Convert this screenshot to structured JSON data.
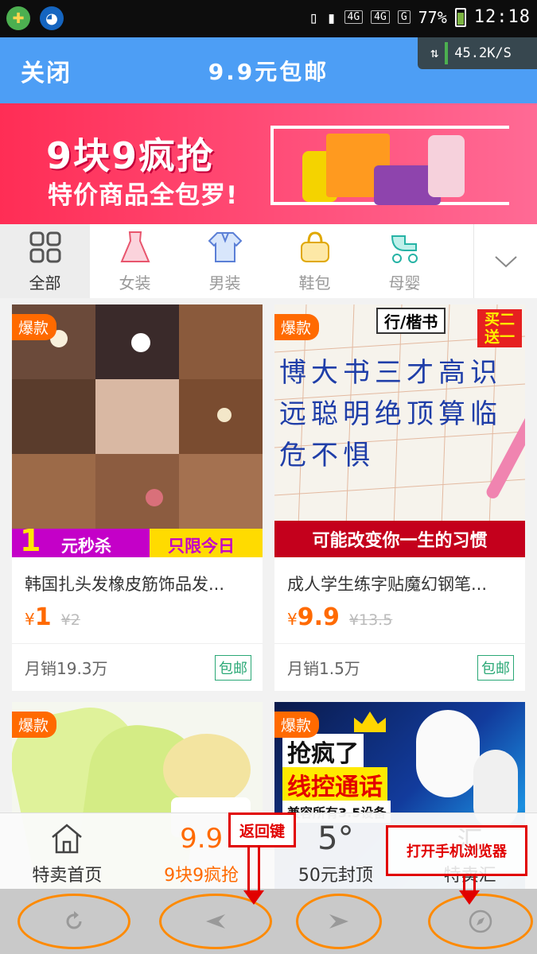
{
  "status_bar": {
    "net_label_1": "4G",
    "net_label_2": "4G",
    "net_label_3": "G",
    "battery": "77%",
    "time": "12:18"
  },
  "header": {
    "close_label": "关闭",
    "title": "9.9元包邮",
    "net_speed": "45.2K/S"
  },
  "banner": {
    "title": "9块9疯抢",
    "subtitle": "特价商品全包罗!"
  },
  "categories": [
    {
      "label": "全部",
      "icon": "grid-icon",
      "active": true
    },
    {
      "label": "女装",
      "icon": "dress-icon",
      "active": false
    },
    {
      "label": "男装",
      "icon": "shirt-icon",
      "active": false
    },
    {
      "label": "鞋包",
      "icon": "handbag-icon",
      "active": false
    },
    {
      "label": "母婴",
      "icon": "stroller-icon",
      "active": false
    }
  ],
  "products": [
    {
      "badge": "爆款",
      "title": "韩国扎头发橡皮筋饰品发...",
      "price_symbol": "¥",
      "price": "1",
      "original_price": "¥2",
      "sales": "月销19.3万",
      "shipping": "包邮",
      "promo_left": "1",
      "promo_mid": "元秒杀",
      "promo_right": "只限今日"
    },
    {
      "badge": "爆款",
      "title": "成人学生练字贴魔幻钢笔...",
      "price_symbol": "¥",
      "price": "9.9",
      "original_price": "¥13.5",
      "sales": "月销1.5万",
      "shipping": "包邮",
      "tag": "行/楷书",
      "deal_1": "买二",
      "deal_2": "送一",
      "slogan": "可能改变你一生的习惯",
      "characters": "博大书三才高识远聪明绝顶算临危不惧"
    },
    {
      "badge": "爆款"
    },
    {
      "badge": "爆款",
      "line1": "抢疯了",
      "line2": "线控通话",
      "line3": "兼容所有3.5设备"
    }
  ],
  "tabbar": [
    {
      "label": "特卖首页",
      "icon": "home-icon",
      "icon_text": "",
      "active": false
    },
    {
      "label": "9块9疯抢",
      "icon": "nine-nine-icon",
      "icon_text": "9.9",
      "active": true
    },
    {
      "label": "50元封顶",
      "icon": "fifty-icon",
      "icon_text": "5°",
      "active": false
    },
    {
      "label": "特卖汇",
      "icon": "special-icon",
      "icon_text": "汇",
      "active": false
    }
  ],
  "browser_nav": {
    "refresh_icon": "refresh-icon",
    "back_icon": "back-arrow-icon",
    "forward_icon": "forward-arrow-icon",
    "compass_icon": "compass-icon",
    "highlight_color": "#ff8a00"
  },
  "annotations": {
    "back_key": "返回键",
    "open_browser": "打开手机浏览器",
    "color": "#e10000"
  }
}
